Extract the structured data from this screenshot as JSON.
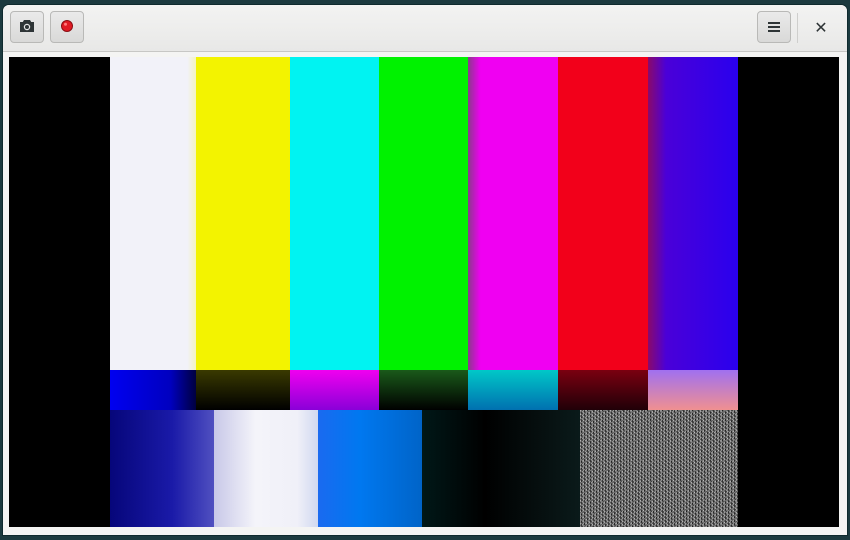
{
  "window": {
    "title": "",
    "controls": {
      "camera_icon": "camera-icon",
      "record_icon": "record-icon",
      "menu_icon": "hamburger-menu-icon",
      "close_glyph": "✕"
    }
  },
  "colors": {
    "headerbar": "#ebebea",
    "record_dot": "#e01b24",
    "viewport_bg": "#000000",
    "bars_top": [
      "#f2f2f9",
      "#f3f300",
      "#00f3f2",
      "#00f200",
      "#f000f2",
      "#f2001a",
      "#2a00ee"
    ],
    "bars_bottom": [
      "#0a0a9a",
      "#f0f0f8",
      "#0078f0",
      "#000000",
      "#000000"
    ]
  }
}
